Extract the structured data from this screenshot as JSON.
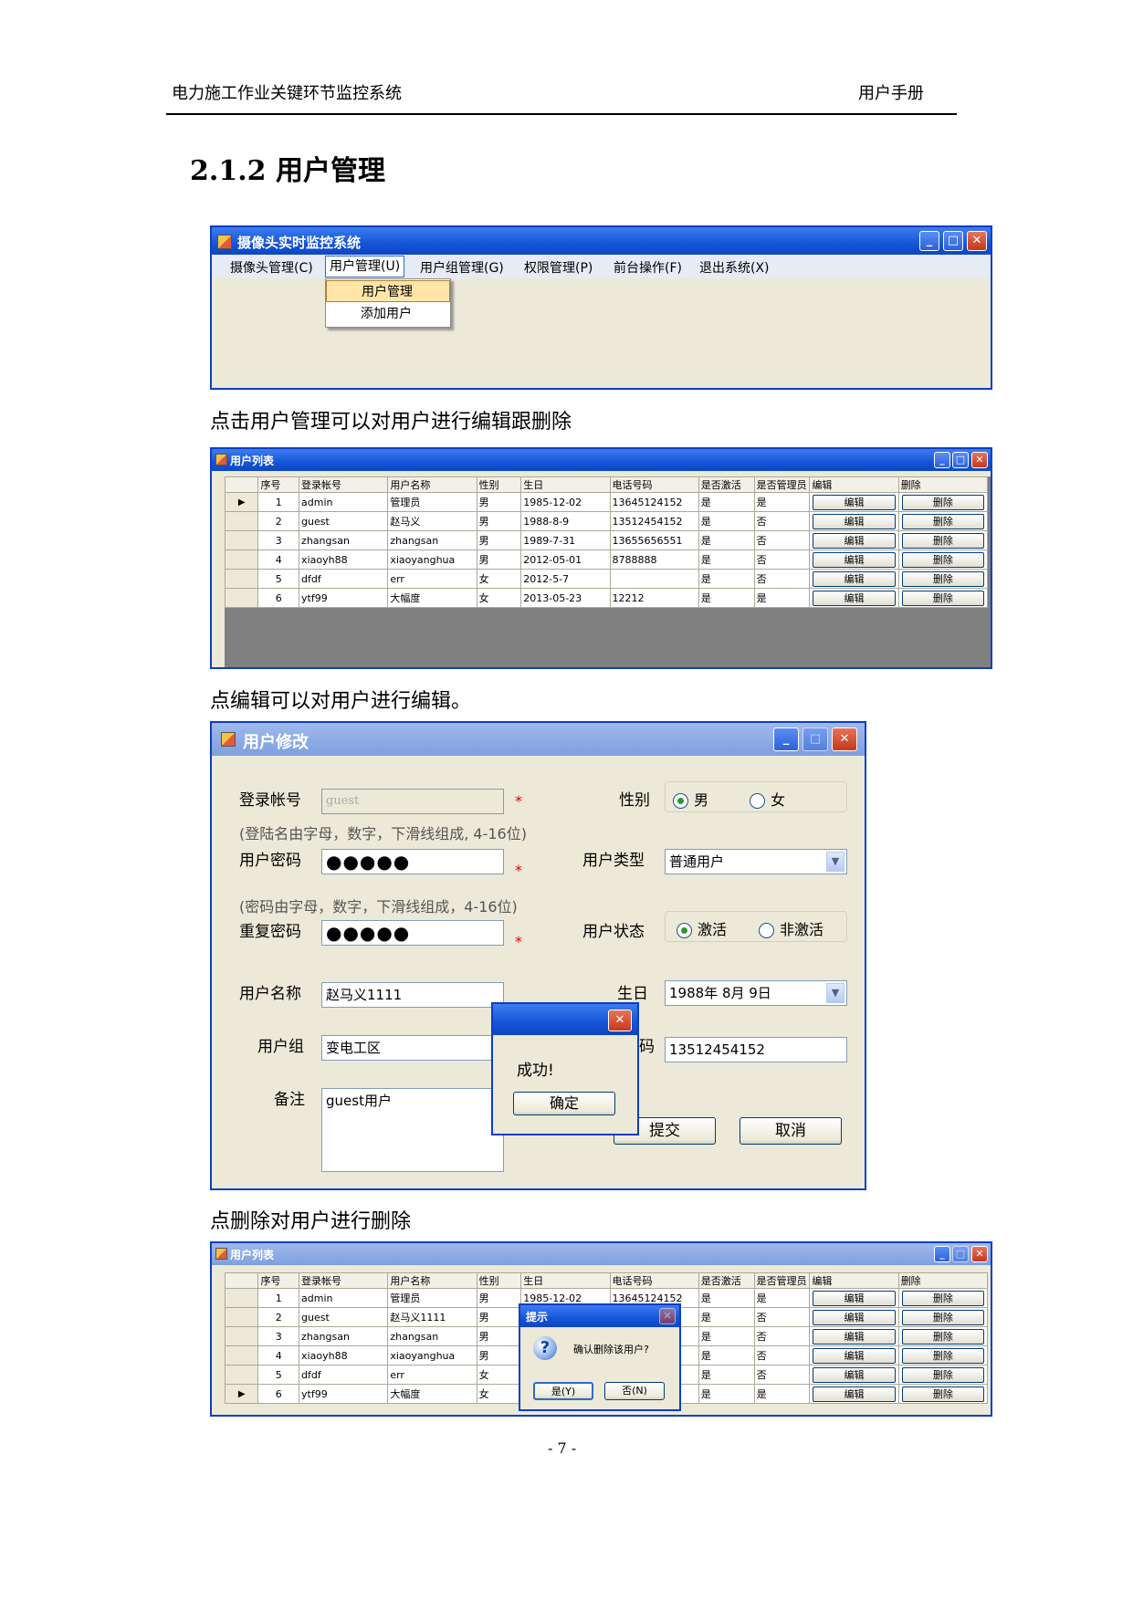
{
  "header": {
    "left": "电力施工作业关键环节监控系统",
    "right": "用户手册"
  },
  "section_title": "2.1.2 用户管理",
  "captions": {
    "c1": "点击用户管理可以对用户进行编辑跟删除",
    "c2": "点编辑可以对用户进行编辑。",
    "c3": "点删除对用户进行删除"
  },
  "page_number": "- 7 -",
  "shot1": {
    "title": "摄像头实时监控系统",
    "menu": [
      "摄像头管理(C)",
      "用户管理(U)",
      "用户组管理(G)",
      "权限管理(P)",
      "前台操作(F)",
      "退出系统(X)"
    ],
    "dropdown": [
      "用户管理",
      "添加用户"
    ]
  },
  "grid_headers": [
    "序号",
    "登录帐号",
    "用户名称",
    "性别",
    "生日",
    "电话号码",
    "是否激活",
    "是否管理员",
    "编辑",
    "删除"
  ],
  "edit_label": "编辑",
  "delete_label": "删除",
  "shot2": {
    "title": "用户列表",
    "rows": [
      [
        "1",
        "admin",
        "管理员",
        "男",
        "1985-12-02",
        "13645124152",
        "是",
        "是"
      ],
      [
        "2",
        "guest",
        "赵马义",
        "男",
        "1988-8-9",
        "13512454152",
        "是",
        "否"
      ],
      [
        "3",
        "zhangsan",
        "zhangsan",
        "男",
        "1989-7-31",
        "13655656551",
        "是",
        "否"
      ],
      [
        "4",
        "xiaoyh88",
        "xiaoyanghua",
        "男",
        "2012-05-01",
        "8788888",
        "是",
        "否"
      ],
      [
        "5",
        "dfdf",
        "err",
        "女",
        "2012-5-7",
        "",
        "是",
        "否"
      ],
      [
        "6",
        "ytf99",
        "大幅度",
        "女",
        "2013-05-23",
        "12212",
        "是",
        "是"
      ]
    ]
  },
  "shot3": {
    "title": "用户修改",
    "login_label": "登录帐号",
    "login_value": "guest",
    "login_hint": "(登陆名由字母，数字，下滑线组成, 4-16位)",
    "pwd_label": "用户密码",
    "pwd_value": "●●●●●",
    "pwd_hint": "(密码由字母，数字，下滑线组成，4-16位)",
    "repwd_label": "重复密码",
    "repwd_value": "●●●●●",
    "name_label": "用户名称",
    "name_value": "赵马义1111",
    "group_label": "用户组",
    "group_value": "变电工区",
    "note_label": "备注",
    "note_value": "guest用户",
    "gender_label": "性别",
    "gender_male": "男",
    "gender_female": "女",
    "type_label": "用户类型",
    "type_value": "普通用户",
    "status_label": "用户状态",
    "status_active": "激活",
    "status_inactive": "非激活",
    "birth_label": "生日",
    "birth_value": "1988年 8月 9日",
    "phone_label_partial": "码",
    "phone_value": "13512454152",
    "submit": "提交",
    "cancel": "取消",
    "msg_text": "成功!",
    "msg_ok": "确定",
    "star": "*"
  },
  "shot4": {
    "title": "用户列表",
    "rows": [
      [
        "1",
        "admin",
        "管理员",
        "男",
        "1985-12-02",
        "13645124152",
        "是",
        "是"
      ],
      [
        "2",
        "guest",
        "赵马义1111",
        "男",
        "",
        "",
        "是",
        "否"
      ],
      [
        "3",
        "zhangsan",
        "zhangsan",
        "男",
        "",
        "",
        "是",
        "否"
      ],
      [
        "4",
        "xiaoyh88",
        "xiaoyanghua",
        "男",
        "",
        "",
        "是",
        "否"
      ],
      [
        "5",
        "dfdf",
        "err",
        "女",
        "",
        "",
        "是",
        "否"
      ],
      [
        "6",
        "ytf99",
        "大幅度",
        "女",
        "",
        "",
        "是",
        "是"
      ]
    ],
    "confirm_title": "提示",
    "confirm_text": "确认删除该用户?",
    "confirm_yes": "是(Y)",
    "confirm_no": "否(N)"
  }
}
